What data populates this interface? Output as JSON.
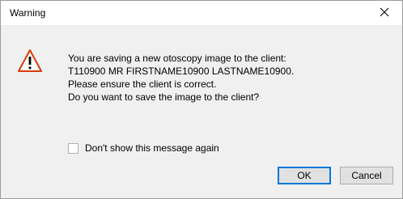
{
  "window": {
    "title": "Warning"
  },
  "icons": {
    "close": "close-icon",
    "warning": "warning-icon"
  },
  "message": {
    "lines": [
      "You are saving a new otoscopy image to the client:",
      "T110900 MR FIRSTNAME10900 LASTNAME10900.",
      "Please ensure the client is correct.",
      "Do you want to save the image to the client?"
    ]
  },
  "checkbox": {
    "label": "Don't show this message again",
    "checked": false
  },
  "buttons": {
    "ok_label": "OK",
    "cancel_label": "Cancel"
  },
  "colors": {
    "accent": "#0078d7",
    "warning_icon_stroke": "#d83b01",
    "client_background": "#f0f0f0"
  }
}
